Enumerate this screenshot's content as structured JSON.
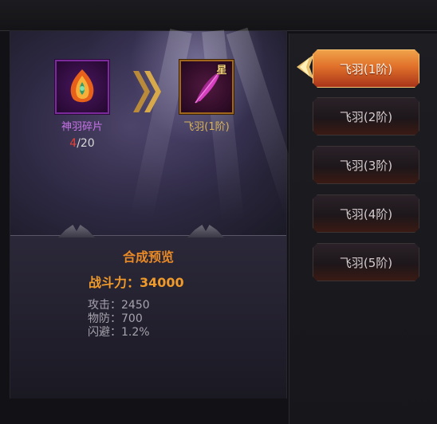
{
  "synthesis": {
    "material": {
      "name": "神羽碎片",
      "have": "4",
      "need": "/20",
      "icon": "phoenix-feather-shard-icon"
    },
    "result": {
      "name": "飞羽(1阶)",
      "badge": "星",
      "icon": "purple-feather-icon"
    }
  },
  "preview": {
    "title": "合成预览",
    "power": "战斗力：34000",
    "stats": [
      "攻击：2450",
      "物防：700",
      "闪避：1.2%"
    ]
  },
  "tabs": [
    {
      "label": "飞羽(1阶)",
      "active": true
    },
    {
      "label": "飞羽(2阶)",
      "active": false
    },
    {
      "label": "飞羽(3阶)",
      "active": false
    },
    {
      "label": "飞羽(4阶)",
      "active": false
    },
    {
      "label": "飞羽(5阶)",
      "active": false
    }
  ],
  "colors": {
    "accent": "#e98a26",
    "tab_active": "#e0702a",
    "shard_text": "#c873e8",
    "count_have": "#e0433a"
  }
}
